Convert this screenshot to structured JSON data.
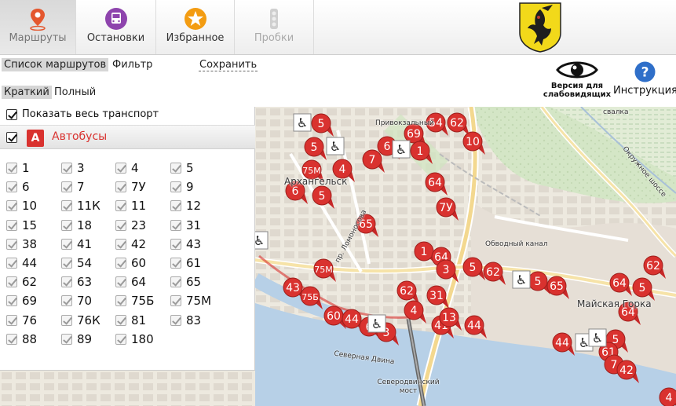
{
  "toolbar": {
    "tabs": [
      {
        "label": "Маршруты",
        "icon": "map-pin-icon"
      },
      {
        "label": "Остановки",
        "icon": "bus-icon"
      },
      {
        "label": "Избранное",
        "icon": "star-icon"
      },
      {
        "label": "Пробки",
        "icon": "traffic-light-icon"
      }
    ],
    "logo": "city-coat-of-arms"
  },
  "subtoolbar": {
    "route_list": "Список маршрутов",
    "filter": "Фильтр",
    "save": "Сохранить",
    "brief": "Краткий",
    "full": "Полный"
  },
  "accessibility": {
    "label_line1": "Версия для",
    "label_line2": "слабовидящих",
    "icon": "eye-icon"
  },
  "help": {
    "label": "Инструкция",
    "icon": "question-icon"
  },
  "panel": {
    "show_all": "Показать весь транспорт",
    "bus_badge": "А",
    "bus_title": "Автобусы",
    "routes": [
      "1",
      "3",
      "4",
      "5",
      "6",
      "7",
      "7У",
      "9",
      "10",
      "11К",
      "11",
      "12",
      "15",
      "18",
      "23",
      "31",
      "38",
      "41",
      "42",
      "43",
      "44",
      "54",
      "60",
      "61",
      "62",
      "63",
      "64",
      "65",
      "69",
      "70",
      "75Б",
      "75М",
      "76",
      "76К",
      "81",
      "83",
      "88",
      "89",
      "180"
    ]
  },
  "map": {
    "places": [
      "Архангельск",
      "Майская Горка",
      "Северная Двина",
      "Северодвинский мост",
      "Привокзальный",
      "Окружное шоссе",
      "свалка",
      "пр. Ломоносова",
      "Обводный канал"
    ],
    "markers": [
      {
        "label": "5"
      },
      {
        "label": "54"
      },
      {
        "label": "62"
      },
      {
        "label": "69"
      },
      {
        "label": "1"
      },
      {
        "label": "10"
      },
      {
        "label": "5"
      },
      {
        "label": "6"
      },
      {
        "label": "7"
      },
      {
        "label": "75М"
      },
      {
        "label": "4"
      },
      {
        "label": "6"
      },
      {
        "label": "5"
      },
      {
        "label": "64"
      },
      {
        "label": "7У"
      },
      {
        "label": "65"
      },
      {
        "label": "1"
      },
      {
        "label": "64"
      },
      {
        "label": "3"
      },
      {
        "label": "5"
      },
      {
        "label": "62"
      },
      {
        "label": "5"
      },
      {
        "label": "65"
      },
      {
        "label": "62"
      },
      {
        "label": "64"
      },
      {
        "label": "5"
      },
      {
        "label": "64"
      },
      {
        "label": "75М"
      },
      {
        "label": "43"
      },
      {
        "label": "75Б"
      },
      {
        "label": "62"
      },
      {
        "label": "31"
      },
      {
        "label": "4"
      },
      {
        "label": "41"
      },
      {
        "label": "13"
      },
      {
        "label": "44"
      },
      {
        "label": "60"
      },
      {
        "label": "44"
      },
      {
        "label": "6"
      },
      {
        "label": "3"
      },
      {
        "label": "44"
      },
      {
        "label": "5"
      },
      {
        "label": "61"
      },
      {
        "label": "7"
      },
      {
        "label": "42"
      },
      {
        "label": "4"
      }
    ],
    "accessible_stops": 8
  }
}
